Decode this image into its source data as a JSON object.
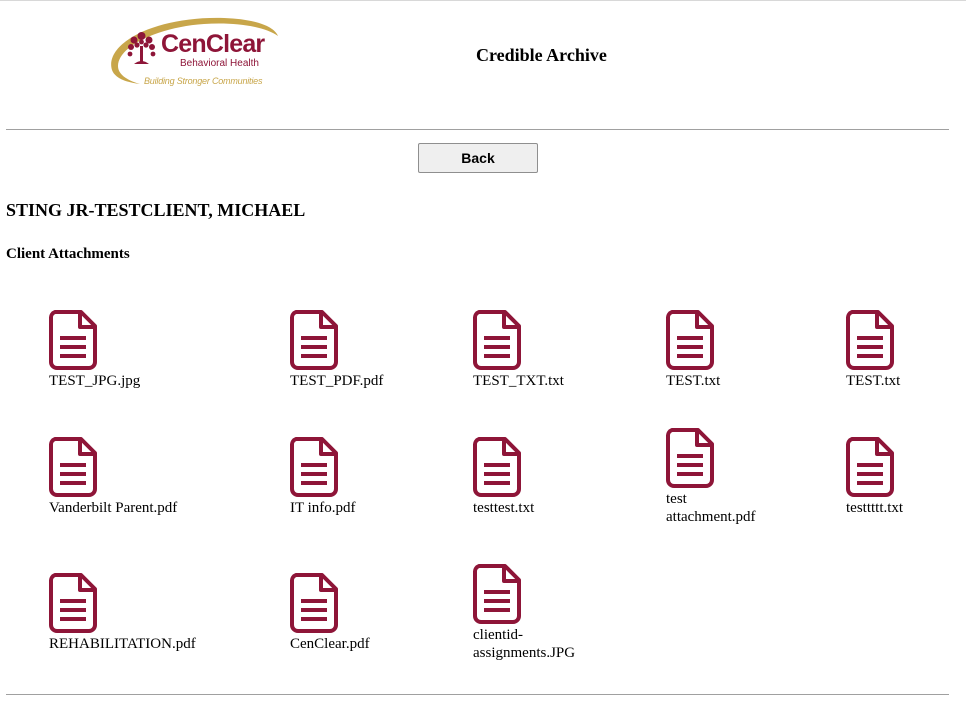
{
  "header": {
    "logo": {
      "name": "CenClear",
      "subtitle": "Behavioral Health",
      "tagline": "Building Stronger Communities"
    },
    "title": "Credible Archive"
  },
  "back_label": "Back",
  "client": {
    "name": "STING JR-TESTCLIENT, MICHAEL"
  },
  "attachments": {
    "heading": "Client Attachments",
    "icon": "document-icon",
    "icon_color": "#8e1538",
    "files": [
      {
        "name": "TEST_JPG.jpg"
      },
      {
        "name": "TEST_PDF.pdf"
      },
      {
        "name": "TEST_TXT.txt"
      },
      {
        "name": "TEST.txt"
      },
      {
        "name": "TEST.txt"
      },
      {
        "name": "Vanderbilt Parent.pdf"
      },
      {
        "name": "IT info.pdf"
      },
      {
        "name": "testtest.txt"
      },
      {
        "name": "test attachment.pdf"
      },
      {
        "name": "testtttt.txt"
      },
      {
        "name": "REHABILITATION.pdf"
      },
      {
        "name": "CenClear.pdf"
      },
      {
        "name": "clientid-assignments.JPG"
      }
    ]
  }
}
